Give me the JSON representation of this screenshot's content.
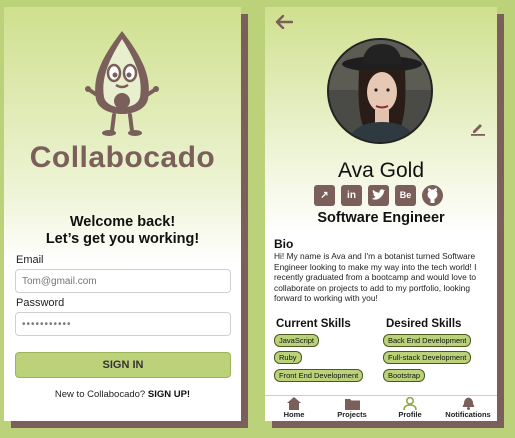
{
  "login": {
    "brand": "Collabocado",
    "welcome_line1": "Welcome back!",
    "welcome_line2": "Let’s get you working!",
    "email_label": "Email",
    "email_placeholder": "Tom@gmail.com",
    "password_label": "Password",
    "password_value": "•••••••••••",
    "signin_label": "SIGN IN",
    "signup_prompt": "New to Collabocado?",
    "signup_link": "SIGN UP!"
  },
  "profile": {
    "name": "Ava Gold",
    "title": "Software Engineer",
    "socials": [
      {
        "icon": "external-link-icon",
        "text": "↗"
      },
      {
        "icon": "linkedin-icon",
        "text": "in"
      },
      {
        "icon": "twitter-icon",
        "text": ""
      },
      {
        "icon": "behance-icon",
        "text": "Be"
      },
      {
        "icon": "github-icon",
        "text": ""
      }
    ],
    "bio_heading": "Bio",
    "bio_text": "Hi! My name is Ava and I'm a botanist turned Software Engineer looking to make my way into the tech world! I recently graduated from a bootcamp and would love to collaborate on projects to add to my portfolio, looking forward to working with you!",
    "current_skills_heading": "Current Skills",
    "current_skills": [
      "JavaScript",
      "Ruby",
      "Front End Development"
    ],
    "desired_skills_heading": "Desired Skills",
    "desired_skills": [
      "Back End Development",
      "Full-stack Development",
      "Bootstrap"
    ]
  },
  "nav": [
    {
      "label": "Home",
      "icon": "home-icon"
    },
    {
      "label": "Projects",
      "icon": "folder-icon"
    },
    {
      "label": "Profile",
      "icon": "person-icon"
    },
    {
      "label": "Notifications",
      "icon": "bell-icon"
    }
  ],
  "colors": {
    "background": "#bcd27a",
    "brand_brown": "#7a5f5a",
    "accent_green": "#bcd27a",
    "active_nav": "#8fa844"
  }
}
